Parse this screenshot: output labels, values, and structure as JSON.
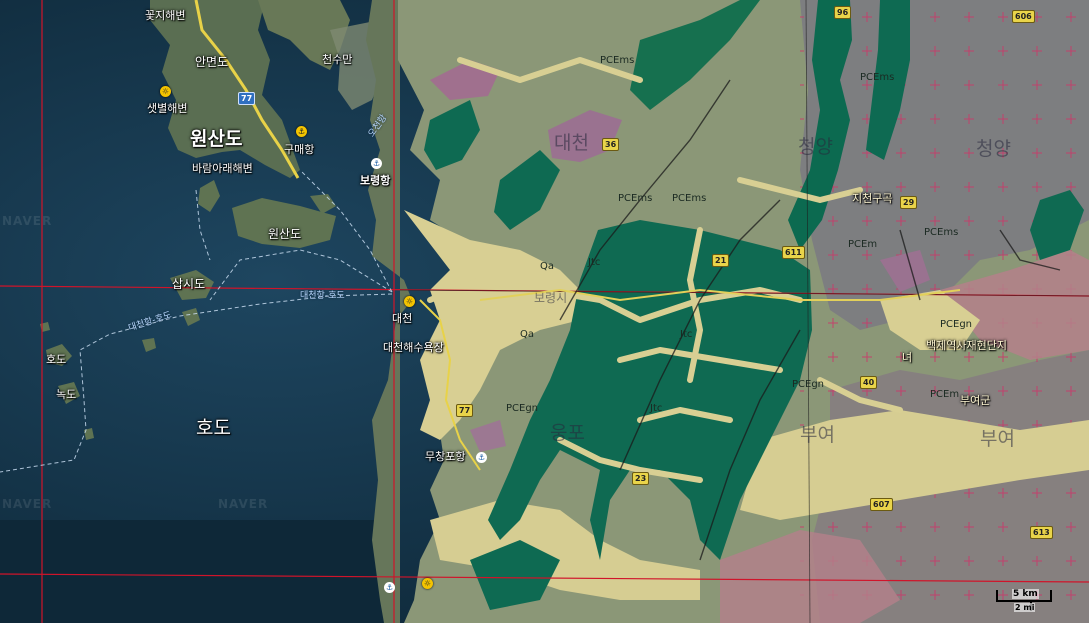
{
  "map": {
    "colors": {
      "sea_deep": "#0f2a3c",
      "sea": "#1d4258",
      "sea_shallow": "#3c6a7e",
      "island_land": "#566a4f",
      "tidal_flat": "#8a9278",
      "geo_base": "#8c9778",
      "geo_alluvium": "#d8d092",
      "geo_green": "#0f6a52",
      "geo_purple": "#9a7290",
      "geo_pink": "#b57f88",
      "geo_gray": "#7d7d80",
      "grid_line": "#d0142a",
      "highway": "#e8d248",
      "ferry_route": "#c8dcf0"
    },
    "place_labels": [
      {
        "id": "kkotji",
        "text": "꽃지해변"
      },
      {
        "id": "anmyeon",
        "text": "안면도"
      },
      {
        "id": "cheonsuman",
        "text": "천수만"
      },
      {
        "id": "saetbyeol",
        "text": "샛별해변"
      },
      {
        "id": "wonsan_big",
        "text": "원산도"
      },
      {
        "id": "gumae",
        "text": "구매항"
      },
      {
        "id": "baram",
        "text": "바람아래해변"
      },
      {
        "id": "boryeong_port",
        "text": "보령항"
      },
      {
        "id": "wonsan_small",
        "text": "원산도"
      },
      {
        "id": "sapsi",
        "text": "삽시도"
      },
      {
        "id": "daecheon",
        "text": "대천"
      },
      {
        "id": "daecheon_beach",
        "text": "대천해수욕장"
      },
      {
        "id": "hodo_small",
        "text": "호도"
      },
      {
        "id": "nokdo",
        "text": "녹도"
      },
      {
        "id": "hodo_big",
        "text": "호도"
      },
      {
        "id": "muchangpo",
        "text": "무창포항"
      },
      {
        "id": "jigeon",
        "text": "지천구곡"
      },
      {
        "id": "baekje",
        "text": "백제역사재현단지"
      },
      {
        "id": "nyeo",
        "text": "녀"
      },
      {
        "id": "buyeo_gu",
        "text": "부여군"
      }
    ],
    "region_labels": [
      {
        "id": "daecheon_region",
        "text": "대천"
      },
      {
        "id": "cheongyang_1",
        "text": "청양"
      },
      {
        "id": "cheongyang_2",
        "text": "청양"
      },
      {
        "id": "boryeong_city",
        "text": "보령시"
      },
      {
        "id": "ungpo",
        "text": "웅포"
      },
      {
        "id": "buyeo_1",
        "text": "부여"
      },
      {
        "id": "buyeo_2",
        "text": "부여"
      }
    ],
    "geology_labels": [
      {
        "id": "g1",
        "text": "PCEms"
      },
      {
        "id": "g2",
        "text": "PCEms"
      },
      {
        "id": "g3",
        "text": "PCEms"
      },
      {
        "id": "g4",
        "text": "PCEm"
      },
      {
        "id": "g5",
        "text": "PCEgn"
      },
      {
        "id": "g6",
        "text": "PCEgn"
      },
      {
        "id": "g7",
        "text": "PCEgn"
      },
      {
        "id": "g8",
        "text": "PCEms"
      },
      {
        "id": "g9",
        "text": "Qa"
      },
      {
        "id": "g10",
        "text": "Qa"
      },
      {
        "id": "g11",
        "text": "Jtc"
      },
      {
        "id": "g12",
        "text": "Jtc"
      },
      {
        "id": "g13",
        "text": "Jtc"
      },
      {
        "id": "g14",
        "text": "PCEms"
      },
      {
        "id": "g15",
        "text": "PCEm"
      }
    ],
    "ferry_routes": [
      {
        "id": "r1",
        "text": "대천항-호도"
      },
      {
        "id": "r2",
        "text": "대천항-호도"
      },
      {
        "id": "r3",
        "text": "오천항"
      }
    ],
    "road_shields": [
      {
        "id": "s77",
        "text": "77",
        "style": "blue"
      },
      {
        "id": "s96",
        "text": "96",
        "style": "yellow"
      },
      {
        "id": "s36",
        "text": "36",
        "style": "yellow"
      },
      {
        "id": "s29",
        "text": "29",
        "style": "yellow"
      },
      {
        "id": "s21",
        "text": "21",
        "style": "yellow"
      },
      {
        "id": "s77b",
        "text": "77",
        "style": "yellow"
      },
      {
        "id": "s40",
        "text": "40",
        "style": "yellow"
      },
      {
        "id": "s23",
        "text": "23",
        "style": "yellow"
      },
      {
        "id": "s607",
        "text": "607",
        "style": "yellow"
      },
      {
        "id": "s613",
        "text": "613",
        "style": "yellow"
      },
      {
        "id": "s611",
        "text": "611",
        "style": "yellow"
      },
      {
        "id": "s606",
        "text": "606",
        "style": "yellow"
      }
    ],
    "watermarks": [
      "NAVER",
      "NAVER",
      "NAVER"
    ],
    "scale_bar": {
      "km_label": "5 km",
      "mi_label": "2 mi"
    }
  }
}
